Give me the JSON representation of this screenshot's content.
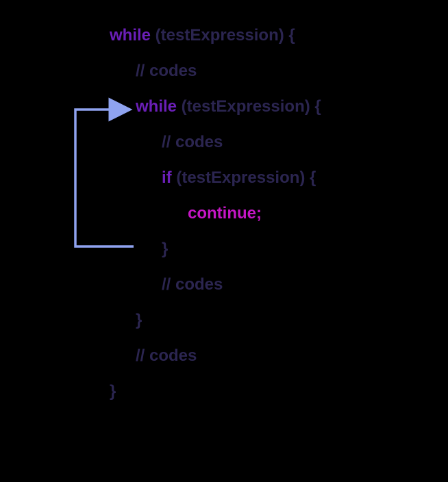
{
  "code": {
    "line1_while": "while",
    "line1_rest": " (testExpression) {",
    "line2": "// codes",
    "line3_while": "while",
    "line3_rest": " (testExpression) {",
    "line4": "// codes",
    "line5_if": "if",
    "line5_rest": " (testExpression) {",
    "line6": "continue;",
    "line7": "}",
    "line8": "// codes",
    "line9": "}",
    "line10": "// codes",
    "line11": "}"
  },
  "colors": {
    "keyword": "#6b1fb8",
    "text": "#2b2550",
    "highlight": "#c516c5",
    "arrow": "#8fa3f0",
    "background": "#000000"
  }
}
